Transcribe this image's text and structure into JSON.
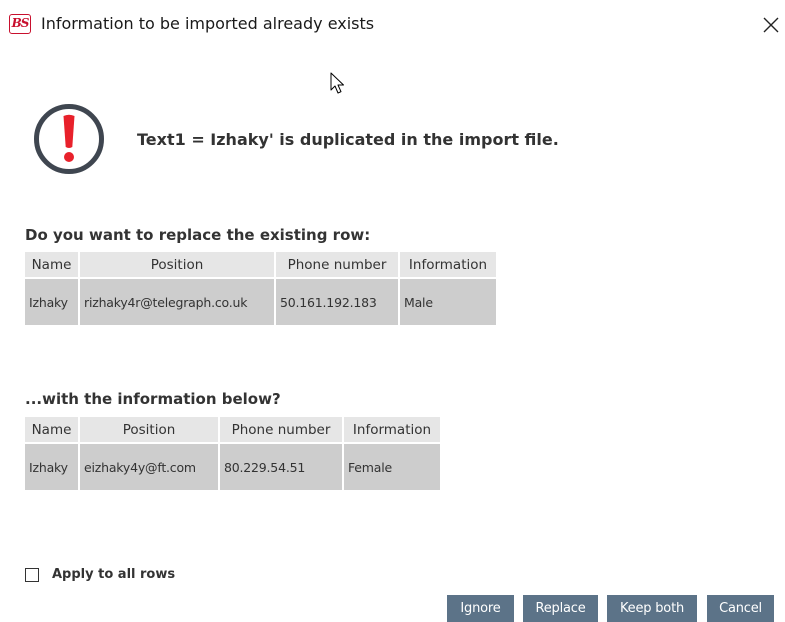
{
  "window": {
    "title": "Information to be imported already exists",
    "app_icon_text": "BS",
    "close_glyph": "close-icon"
  },
  "message": "Text1 = Izhaky' is duplicated in the import file.",
  "existing": {
    "heading": "Do you want to replace the existing row:",
    "columns": [
      "Name",
      "Position",
      "Phone number",
      "Information"
    ],
    "row": [
      "Izhaky",
      "rizhaky4r@telegraph.co.uk",
      "50.161.192.183",
      "Male"
    ]
  },
  "incoming": {
    "heading": "...with the information below?",
    "columns": [
      "Name",
      "Position",
      "Phone number",
      "Information"
    ],
    "row": [
      "Izhaky",
      "eizhaky4y@ft.com",
      "80.229.54.51",
      "Female"
    ]
  },
  "apply_all": {
    "label": "Apply to all rows",
    "checked": false
  },
  "buttons": {
    "ignore": "Ignore",
    "replace": "Replace",
    "keep_both": "Keep both",
    "cancel": "Cancel"
  },
  "colors": {
    "accent_red": "#c8102e",
    "alert_red": "#e8212b",
    "alert_ring": "#3f4650",
    "button_bg": "#5c7388",
    "header_bg": "#e6e6e6",
    "cell_bg": "#cdcdcd"
  }
}
